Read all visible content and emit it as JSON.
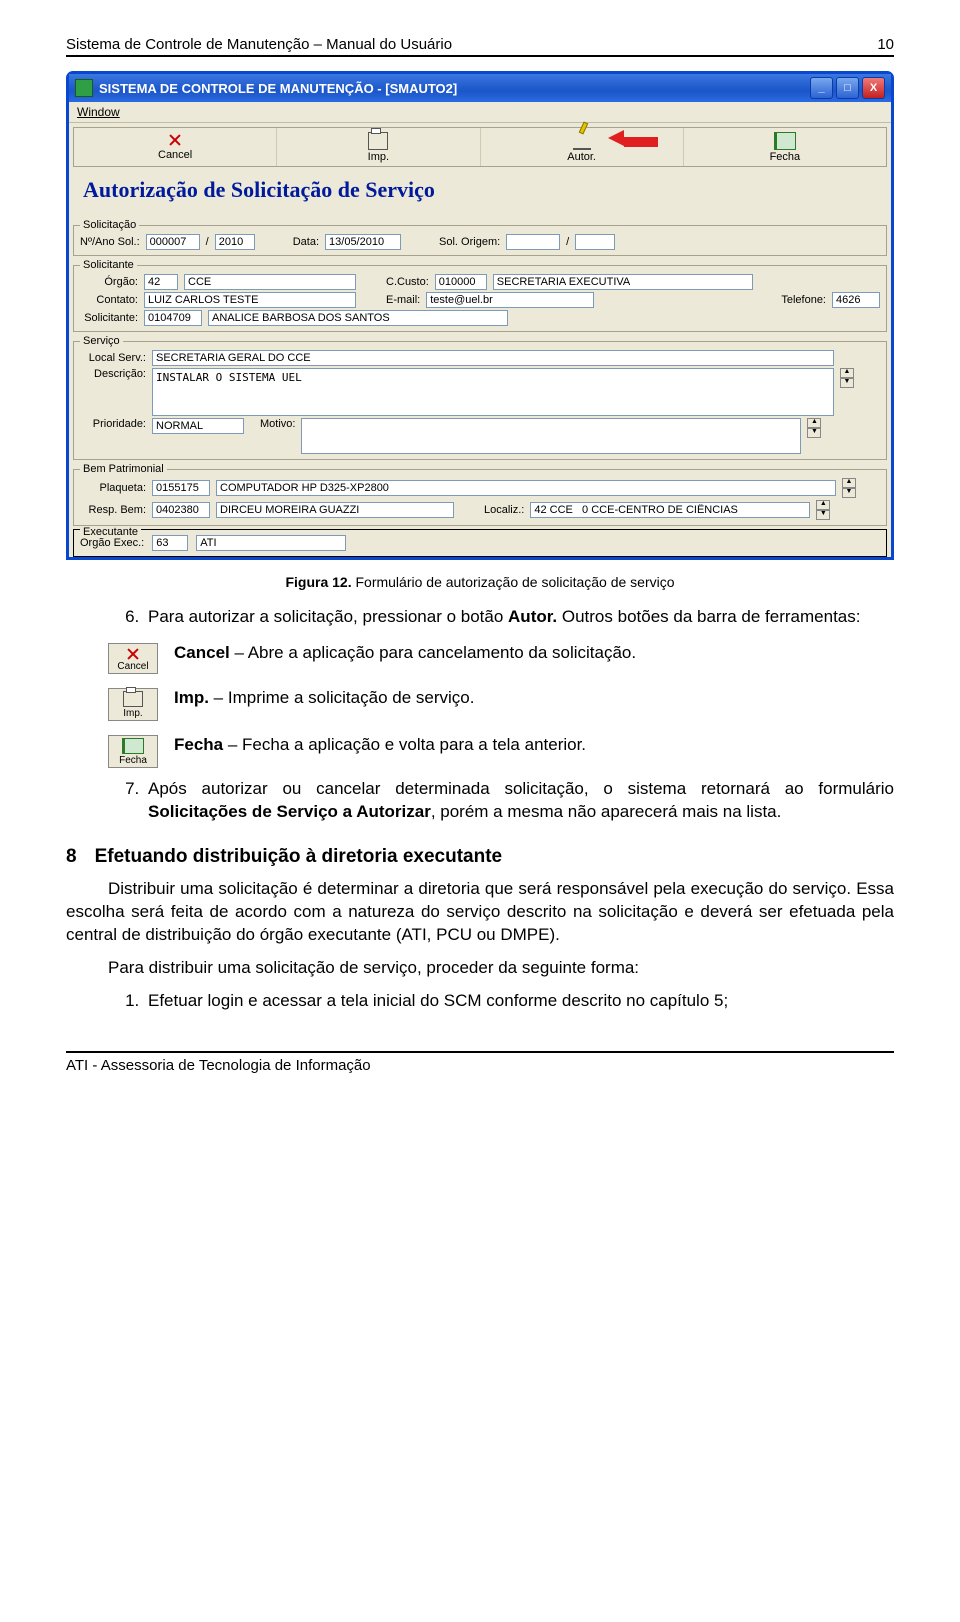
{
  "header": {
    "title": "Sistema de Controle de Manutenção – Manual do Usuário",
    "page": "10"
  },
  "window": {
    "app_title": "SISTEMA DE CONTROLE DE MANUTENÇÃO - [SMAUTO2]",
    "menu": {
      "window": "Window"
    },
    "win_buttons": {
      "min": "_",
      "max": "□",
      "close": "X"
    },
    "toolbar": {
      "cancel": "Cancel",
      "imp": "Imp.",
      "autor": "Autor.",
      "fecha": "Fecha"
    },
    "big_heading": "Autorização de Solicitação de Serviço",
    "groups": {
      "solicitacao": {
        "legend": "Solicitação",
        "num_label": "Nº/Ano Sol.:",
        "num": "000007",
        "sep": "/",
        "ano": "2010",
        "data_label": "Data:",
        "data": "13/05/2010",
        "origem_label": "Sol. Origem:",
        "origem_num": "",
        "origem_sep": "/",
        "origem_ano": ""
      },
      "solicitante": {
        "legend": "Solicitante",
        "orgao_label": "Órgão:",
        "orgao_cod": "42",
        "orgao_nome": "CCE",
        "ccusto_label": "C.Custo:",
        "ccusto_cod": "010000",
        "ccusto_nome": "SECRETARIA EXECUTIVA",
        "contato_label": "Contato:",
        "contato": "LUIZ CARLOS TESTE",
        "email_label": "E-mail:",
        "email": "teste@uel.br",
        "tel_label": "Telefone:",
        "tel": "4626",
        "solic_label": "Solicitante:",
        "solic_cod": "0104709",
        "solic_nome": "ANALICE BARBOSA DOS SANTOS"
      },
      "servico": {
        "legend": "Serviço",
        "local_label": "Local Serv.:",
        "local": "SECRETARIA GERAL DO CCE",
        "descr_label": "Descrição:",
        "descr": "INSTALAR O SISTEMA UEL",
        "prio_label": "Prioridade:",
        "prio": "NORMAL",
        "motivo_label": "Motivo:",
        "motivo": ""
      },
      "bem": {
        "legend": "Bem Patrimonial",
        "plaq_label": "Plaqueta:",
        "plaq_cod": "0155175",
        "plaq_nome": "COMPUTADOR HP D325-XP2800",
        "resp_label": "Resp. Bem:",
        "resp_cod": "0402380",
        "resp_nome": "DIRCEU MOREIRA GUAZZI",
        "loc_label": "Localiz.:",
        "loc": "42 CCE   0 CCE-CENTRO DE CIÊNCIAS"
      },
      "executante": {
        "legend": "Executante",
        "label": "Órgão Exec.:",
        "cod": "63",
        "nome": "ATI"
      }
    }
  },
  "caption": {
    "prefix": "Figura 12.",
    "text": " Formulário de autorização de solicitação de serviço"
  },
  "step6": {
    "num": "6.",
    "text_a": "Para autorizar a solicitação, pressionar o botão ",
    "bold": "Autor.",
    "text_b": "Outros botões da barra de ferramentas:"
  },
  "buttons_desc": {
    "cancel": {
      "label": "Cancel",
      "bold": "Cancel",
      "rest": " – Abre a aplicação para cancelamento da solicitação."
    },
    "imp": {
      "label": "Imp.",
      "bold": "Imp.",
      "rest": " – Imprime a solicitação de serviço."
    },
    "fecha": {
      "label": "Fecha",
      "bold": "Fecha",
      "rest": " – Fecha a aplicação e volta para a tela anterior."
    }
  },
  "step7": {
    "num": "7.",
    "text_a": "Após autorizar ou cancelar determinada solicitação, o sistema retornará ao formulário ",
    "bold": "Solicitações de Serviço a Autorizar",
    "text_b": ", porém a mesma não aparecerá mais na lista."
  },
  "section8": {
    "num": "8",
    "title": "Efetuando distribuição à diretoria executante",
    "p1": "Distribuir uma solicitação é determinar a diretoria que será responsável pela execução do serviço. Essa escolha será feita de acordo com a natureza do serviço descrito na solicitação e deverá ser efetuada pela central de distribuição do órgão executante (ATI, PCU ou DMPE).",
    "p2": "Para distribuir uma solicitação de serviço, proceder da seguinte forma:",
    "li1": "Efetuar login e acessar a tela inicial do SCM conforme descrito no capítulo 5;"
  },
  "footer": "ATI - Assessoria de Tecnologia de Informação"
}
